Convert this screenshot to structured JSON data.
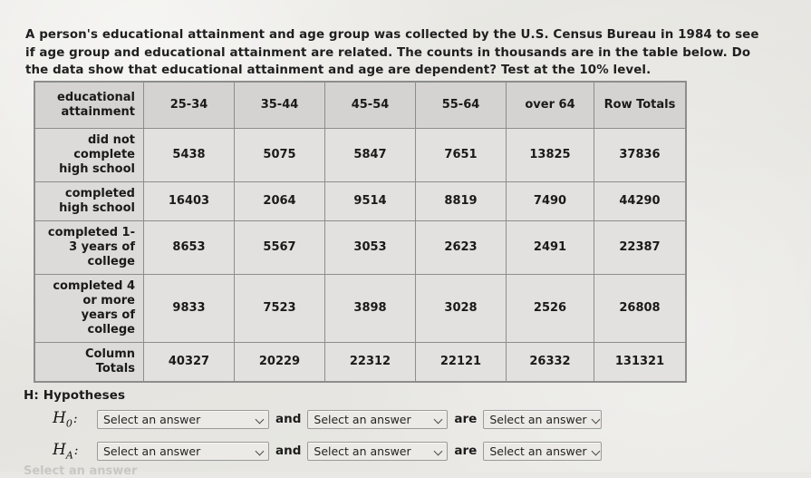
{
  "prompt": {
    "text": "A person's educational attainment and age group was collected by the U.S. Census Bureau in 1984 to see if age group and educational attainment are related. The counts in thousands are in the table below. Do the data show that educational attainment and age are dependent? Test at the 10% level."
  },
  "table": {
    "corner_label": "educational attainment",
    "column_headers": [
      "25-34",
      "35-44",
      "45-54",
      "55-64",
      "over 64",
      "Row Totals"
    ],
    "rows": [
      {
        "label": "did not complete high school",
        "values": [
          "5438",
          "5075",
          "5847",
          "7651",
          "13825",
          "37836"
        ]
      },
      {
        "label": "completed high school",
        "values": [
          "16403",
          "2064",
          "9514",
          "8819",
          "7490",
          "44290"
        ]
      },
      {
        "label": "completed 1-3 years of college",
        "values": [
          "8653",
          "5567",
          "3053",
          "2623",
          "2491",
          "22387"
        ]
      },
      {
        "label": "completed 4 or more years of college",
        "values": [
          "9833",
          "7523",
          "3898",
          "3028",
          "2526",
          "26808"
        ]
      },
      {
        "label": "Column Totals",
        "values": [
          "40327",
          "20229",
          "22312",
          "22121",
          "26332",
          "131321"
        ]
      }
    ]
  },
  "hypotheses": {
    "title": "H: Hypotheses",
    "null_label": "H",
    "null_sub": "0",
    "alt_label": "H",
    "alt_sub": "A",
    "colon": ":",
    "conjunction": "and",
    "verb": "are",
    "select_placeholder": "Select an answer",
    "caret_icon": "chevron-down-icon"
  },
  "footer": {
    "cut_off_text": "Select an answer"
  },
  "colors": {
    "page_background": "#e9e8e4",
    "table_border": "#8d8d8d",
    "header_fill": "#d4d3d1",
    "cell_fill": "#e2e1df",
    "label_fill": "#dcdbd9",
    "text": "#1c1c1c",
    "dropdown_fill": "#eceae6",
    "dropdown_border": "#9a9a9a"
  }
}
